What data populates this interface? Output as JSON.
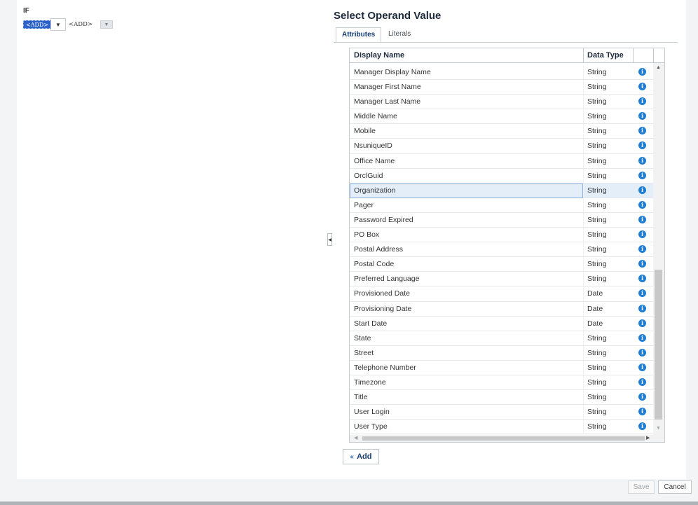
{
  "condition": {
    "keyword": "IF",
    "left_operand": "<ADD>",
    "operator_caret": "▼",
    "right_operand": "<ADD>",
    "right_dropdown_caret": "▼"
  },
  "panel": {
    "title": "Select Operand Value",
    "tabs": [
      {
        "label": "Attributes",
        "active": true
      },
      {
        "label": "Literals",
        "active": false
      }
    ]
  },
  "table": {
    "columns": [
      "Display Name",
      "Data Type"
    ],
    "selected_row": "Organization",
    "info_icon": "i",
    "rows": [
      {
        "name": "Manager Display Name",
        "type": "String"
      },
      {
        "name": "Manager First Name",
        "type": "String"
      },
      {
        "name": "Manager Last Name",
        "type": "String"
      },
      {
        "name": "Middle Name",
        "type": "String"
      },
      {
        "name": "Mobile",
        "type": "String"
      },
      {
        "name": "NsuniqueID",
        "type": "String"
      },
      {
        "name": "Office Name",
        "type": "String"
      },
      {
        "name": "OrclGuid",
        "type": "String"
      },
      {
        "name": "Organization",
        "type": "String"
      },
      {
        "name": "Pager",
        "type": "String"
      },
      {
        "name": "Password Expired",
        "type": "String"
      },
      {
        "name": "PO Box",
        "type": "String"
      },
      {
        "name": "Postal Address",
        "type": "String"
      },
      {
        "name": "Postal Code",
        "type": "String"
      },
      {
        "name": "Preferred Language",
        "type": "String"
      },
      {
        "name": "Provisioned Date",
        "type": "Date"
      },
      {
        "name": "Provisioning Date",
        "type": "Date"
      },
      {
        "name": "Start Date",
        "type": "Date"
      },
      {
        "name": "State",
        "type": "String"
      },
      {
        "name": "Street",
        "type": "String"
      },
      {
        "name": "Telephone Number",
        "type": "String"
      },
      {
        "name": "Timezone",
        "type": "String"
      },
      {
        "name": "Title",
        "type": "String"
      },
      {
        "name": "User Login",
        "type": "String"
      },
      {
        "name": "User Type",
        "type": "String"
      }
    ]
  },
  "buttons": {
    "add": "Add",
    "add_icon": "«",
    "save": "Save",
    "cancel": "Cancel"
  },
  "colors": {
    "accent": "#2a62c9",
    "info_icon": "#1f7ed4",
    "selected_row": "#e3eef9"
  }
}
